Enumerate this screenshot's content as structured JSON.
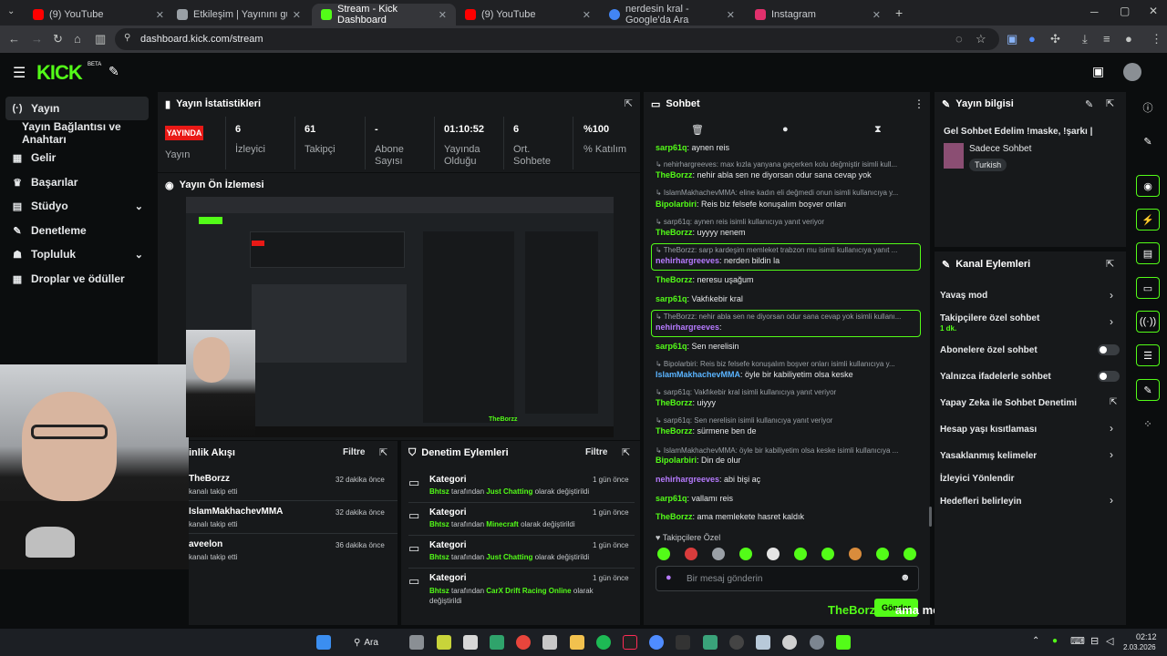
{
  "browser": {
    "tabs": [
      {
        "title": "(9) YouTube",
        "fav": "#ff0000"
      },
      {
        "title": "Etkileşim | Yayınını güçlendirme",
        "fav": "#9aa0a6"
      },
      {
        "title": "Stream - Kick Dashboard",
        "fav": "#53fc18"
      },
      {
        "title": "(9) YouTube",
        "fav": "#ff0000"
      },
      {
        "title": "nerdesin kral - Google'da Ara",
        "fav": "#4285f4"
      },
      {
        "title": "Instagram",
        "fav": "#e1306c"
      }
    ],
    "url": "dashboard.kick.com/stream"
  },
  "header": {
    "logo": "KICK",
    "beta": "BETA"
  },
  "sidebar": {
    "items": [
      {
        "label": "Yayın",
        "icon": "antenna-icon"
      },
      {
        "label": "Yayın Bağlantısı ve Anahtarı",
        "icon": ""
      },
      {
        "label": "Gelir",
        "icon": "dollar-icon"
      },
      {
        "label": "Başarılar",
        "icon": "trophy-icon"
      },
      {
        "label": "Stüdyo",
        "icon": "studio-icon"
      },
      {
        "label": "Denetleme",
        "icon": "wrench-icon"
      },
      {
        "label": "Topluluk",
        "icon": "people-icon"
      },
      {
        "label": "Droplar ve ödüller",
        "icon": "gift-icon"
      }
    ]
  },
  "stats": {
    "title": "Yayın İstatistikleri",
    "live_badge": "YAYINDA",
    "status_label": "Yayın",
    "items": [
      {
        "value": "6",
        "label": "İzleyici"
      },
      {
        "value": "61",
        "label": "Takipçi"
      },
      {
        "value": "-",
        "label": "Abone Sayısı"
      },
      {
        "value": "01:10:52",
        "label": "Yayında Olduğu"
      },
      {
        "value": "6",
        "label": "Ort. Sohbete"
      },
      {
        "value": "%100",
        "label": "% Katılım"
      }
    ]
  },
  "preview": {
    "title": "Yayın Ön İzlemesi",
    "overlay_text": "TheBorzz",
    "overlay_msg": "ama memlekete hasret kaldık",
    "send_label": "Gönder"
  },
  "activity": {
    "title": "inlik Akışı",
    "filter": "Filtre",
    "items": [
      {
        "user": "TheBorzz",
        "action": "kanalı takip etti",
        "time": "32 dakika önce"
      },
      {
        "user": "IslamMakhachevMMA",
        "action": "kanalı takip etti",
        "time": "32 dakika önce"
      },
      {
        "user": "aveelon",
        "action": "kanalı takip etti",
        "time": "36 dakika önce"
      }
    ]
  },
  "moderation": {
    "title": "Denetim Eylemleri",
    "filter": "Filtre",
    "items": [
      {
        "title": "Kategori",
        "time": "1 gün önce",
        "by": "Bhtsz",
        "mid": "tarafından",
        "cat": "Just Chatting",
        "end": "olarak değiştirildi"
      },
      {
        "title": "Kategori",
        "time": "1 gün önce",
        "by": "Bhtsz",
        "mid": "tarafından",
        "cat": "Minecraft",
        "end": "olarak değiştirildi"
      },
      {
        "title": "Kategori",
        "time": "1 gün önce",
        "by": "Bhtsz",
        "mid": "tarafından",
        "cat": "Just Chatting",
        "end": "olarak değiştirildi"
      },
      {
        "title": "Kategori",
        "time": "1 gün önce",
        "by": "Bhtsz",
        "mid": "tarafından",
        "cat": "CarX Drift Racing Online",
        "end": "olarak değiştirildi"
      }
    ]
  },
  "chat": {
    "title": "Sohbet",
    "lines": [
      {
        "user": "sarp61q",
        "color": "#53fc18",
        "text": ": aynen reis",
        "sys": ""
      },
      {
        "user": "",
        "color": "",
        "text": "",
        "sys": "↳ nehirhargreeves: max kızla yanyana geçerken kolu değmiştir isimli kull..."
      },
      {
        "user": "TheBorzz",
        "color": "#53fc18",
        "text": ": nehir abla sen ne diyorsan odur sana cevap yok",
        "sys": ""
      },
      {
        "user": "",
        "color": "",
        "text": "",
        "sys": "↳ IslamMakhachevMMA: eline kadın eli değmedi onun isimli kullanıcıya y..."
      },
      {
        "user": "Bipolarbiri",
        "color": "#53fc18",
        "text": ": Reis biz felsefe konuşalım boşver onları",
        "sys": ""
      },
      {
        "user": "",
        "color": "",
        "text": "",
        "sys": "↳ sarp61q: aynen reis isimli kullanıcıya yanıt veriyor"
      },
      {
        "user": "TheBorzz",
        "color": "#53fc18",
        "text": ": uyyyy nenem",
        "sys": ""
      },
      {
        "user": "",
        "color": "",
        "text": "",
        "sys": "↳ TheBorzz: sarp kardeşim memleket trabzon mu isimli kullanıcıya yanıt ..."
      },
      {
        "user": "nehirhargreeves",
        "color": "#b77bff",
        "text": ": nerden bildin la",
        "sys": ""
      },
      {
        "user": "TheBorzz",
        "color": "#53fc18",
        "text": ": neresu uşağum",
        "sys": ""
      },
      {
        "user": "sarp61q",
        "color": "#53fc18",
        "text": ": Vakfıkebir kral",
        "sys": ""
      },
      {
        "user": "",
        "color": "",
        "text": "",
        "sys": "↳ TheBorzz: nehir abla sen ne diyorsan odur sana cevap yok isimli kullanı..."
      },
      {
        "user": "nehirhargreeves",
        "color": "#b77bff",
        "text": ":",
        "sys": ""
      },
      {
        "user": "sarp61q",
        "color": "#53fc18",
        "text": ": Sen nerelisin",
        "sys": ""
      },
      {
        "user": "",
        "color": "",
        "text": "",
        "sys": "↳ Bipolarbiri: Reis biz felsefe konuşalım boşver onları isimli kullanıcıya y..."
      },
      {
        "user": "IslamMakhachevMMA",
        "color": "#5ab4ff",
        "text": ": öyle bir kabiliyetim olsa keske",
        "sys": ""
      },
      {
        "user": "",
        "color": "",
        "text": "",
        "sys": "↳ sarp61q: Vakfıkebir kral isimli kullanıcıya yanıt veriyor"
      },
      {
        "user": "TheBorzz",
        "color": "#53fc18",
        "text": ": uiyyy",
        "sys": ""
      },
      {
        "user": "",
        "color": "",
        "text": "",
        "sys": "↳ sarp61q: Sen nerelisin isimli kullanıcıya yanıt veriyor"
      },
      {
        "user": "TheBorzz",
        "color": "#53fc18",
        "text": ": sürmene ben de",
        "sys": ""
      },
      {
        "user": "",
        "color": "",
        "text": "",
        "sys": "↳ IslamMakhachevMMA: öyle bir kabiliyetim olsa keske isimli kullanıcıya ..."
      },
      {
        "user": "Bipolarbiri",
        "color": "#53fc18",
        "text": ": Din de olur",
        "sys": ""
      },
      {
        "user": "nehirhargreeves",
        "color": "#b77bff",
        "text": ": abi bişi aç",
        "sys": ""
      },
      {
        "user": "sarp61q",
        "color": "#53fc18",
        "text": ": vallamı reis",
        "sys": ""
      },
      {
        "user": "TheBorzz",
        "color": "#53fc18",
        "text": ": ama memlekete hasret kaldık",
        "sys": ""
      }
    ],
    "followers_only": "Takipçilere Özel",
    "placeholder": "Bir mesaj gönderin"
  },
  "info": {
    "title": "Yayın bilgisi",
    "stream_title": "Gel Sohbet Edelim !maske, !şarkı |",
    "category": "Sadece Sohbet",
    "tag": "Turkish"
  },
  "channel_actions": {
    "title": "Kanal Eylemleri",
    "items": [
      {
        "label": "Yavaş mod",
        "sub": "",
        "ctrl": "chevron"
      },
      {
        "label": "Takipçilere özel sohbet",
        "sub": "1 dk.",
        "ctrl": "chevron"
      },
      {
        "label": "Abonelere özel sohbet",
        "sub": "",
        "ctrl": "toggle"
      },
      {
        "label": "Yalnızca ifadelerle sohbet",
        "sub": "",
        "ctrl": "toggle"
      },
      {
        "label": "Yapay Zeka ile Sohbet Denetimi",
        "sub": "",
        "ctrl": "external"
      },
      {
        "label": "Hesap yaşı kısıtlaması",
        "sub": "",
        "ctrl": "chevron"
      },
      {
        "label": "Yasaklanmış kelimeler",
        "sub": "",
        "ctrl": "chevron"
      },
      {
        "label": "İzleyici Yönlendir",
        "sub": "",
        "ctrl": ""
      },
      {
        "label": "Hedefleri belirleyin",
        "sub": "",
        "ctrl": "chevron"
      }
    ]
  },
  "taskbar": {
    "search": "Ara",
    "time": "02:12",
    "date": "2.03.2026"
  }
}
